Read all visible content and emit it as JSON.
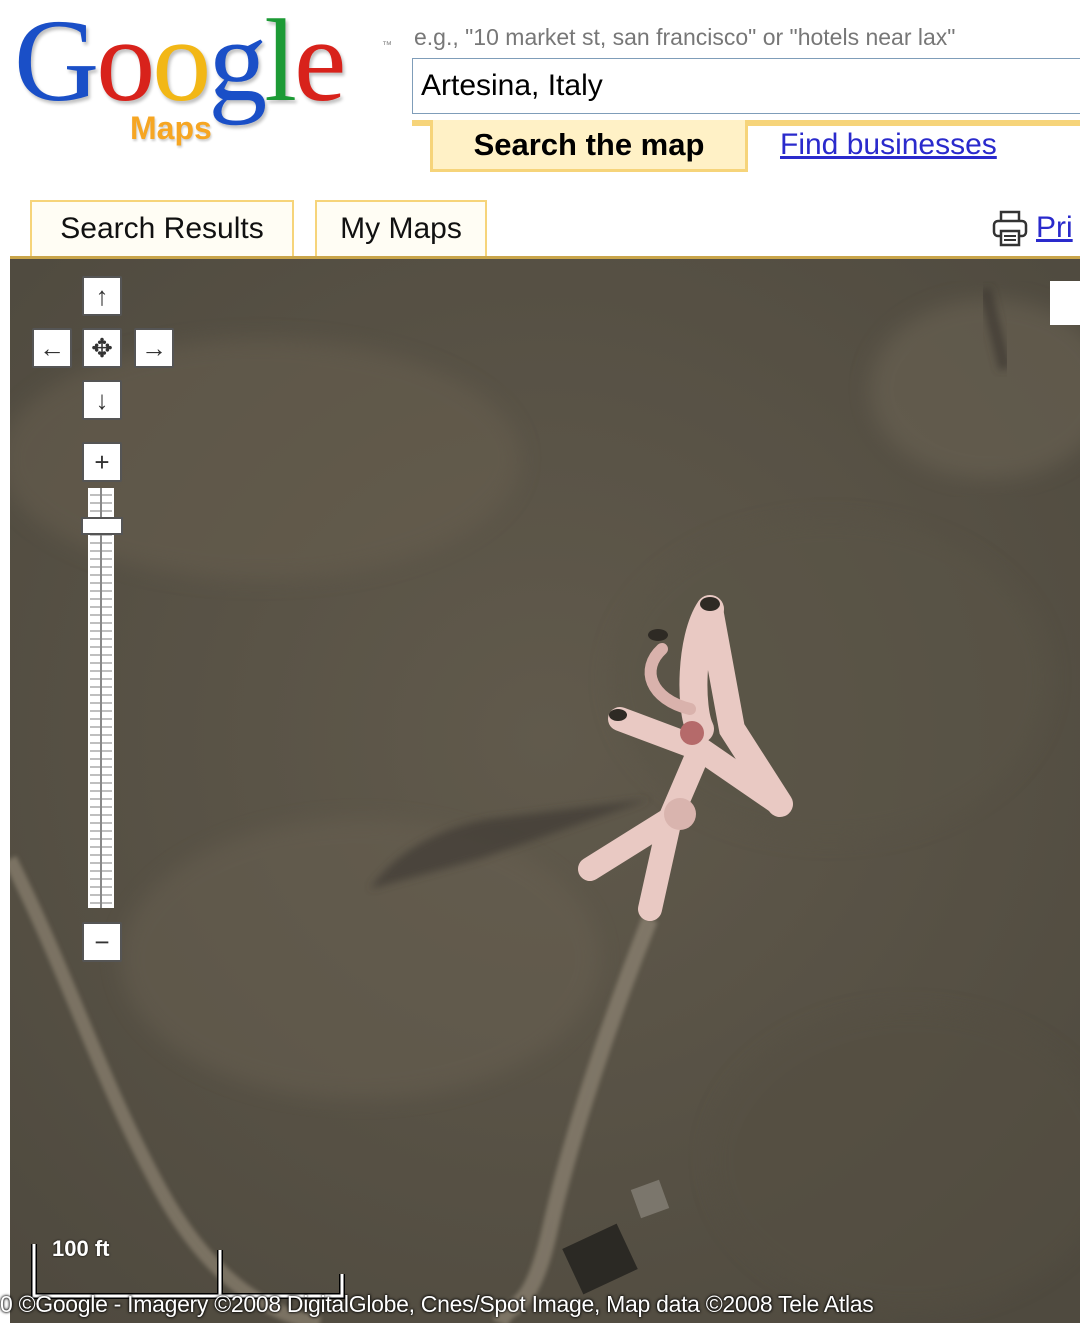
{
  "logo": {
    "letters": [
      {
        "ch": "G",
        "color": "#1a4fc7"
      },
      {
        "ch": "o",
        "color": "#d8221b"
      },
      {
        "ch": "o",
        "color": "#f2b716"
      },
      {
        "ch": "g",
        "color": "#1a4fc7"
      },
      {
        "ch": "l",
        "color": "#1c9a35"
      },
      {
        "ch": "e",
        "color": "#d8221b"
      }
    ],
    "subtitle": "Maps",
    "trademark": "™"
  },
  "search": {
    "hint": "e.g., \"10 market st, san francisco\" or \"hotels near lax\"",
    "value": "Artesina, Italy",
    "tab_active": "Search the map",
    "tab_other": "Find businesses"
  },
  "panel": {
    "tab_results": "Search Results",
    "tab_mymaps": "My Maps",
    "print_label": "Pri"
  },
  "controls": {
    "pan_up": "↑",
    "pan_down": "↓",
    "pan_left": "←",
    "pan_right": "→",
    "reset": "✥",
    "zoom_in": "+",
    "zoom_out": "−",
    "zoom_level": 0.07
  },
  "map": {
    "scale_label": "100 ft",
    "copyright": "0 ©Google - Imagery ©2008 DigitalGlobe, Cnes/Spot Image, Map data ©2008 Tele Atlas"
  },
  "colors": {
    "link": "#2a2acc",
    "tab_border": "#f6d47a",
    "tab_fill": "#fff1c6",
    "terrain": "#5d5749"
  }
}
